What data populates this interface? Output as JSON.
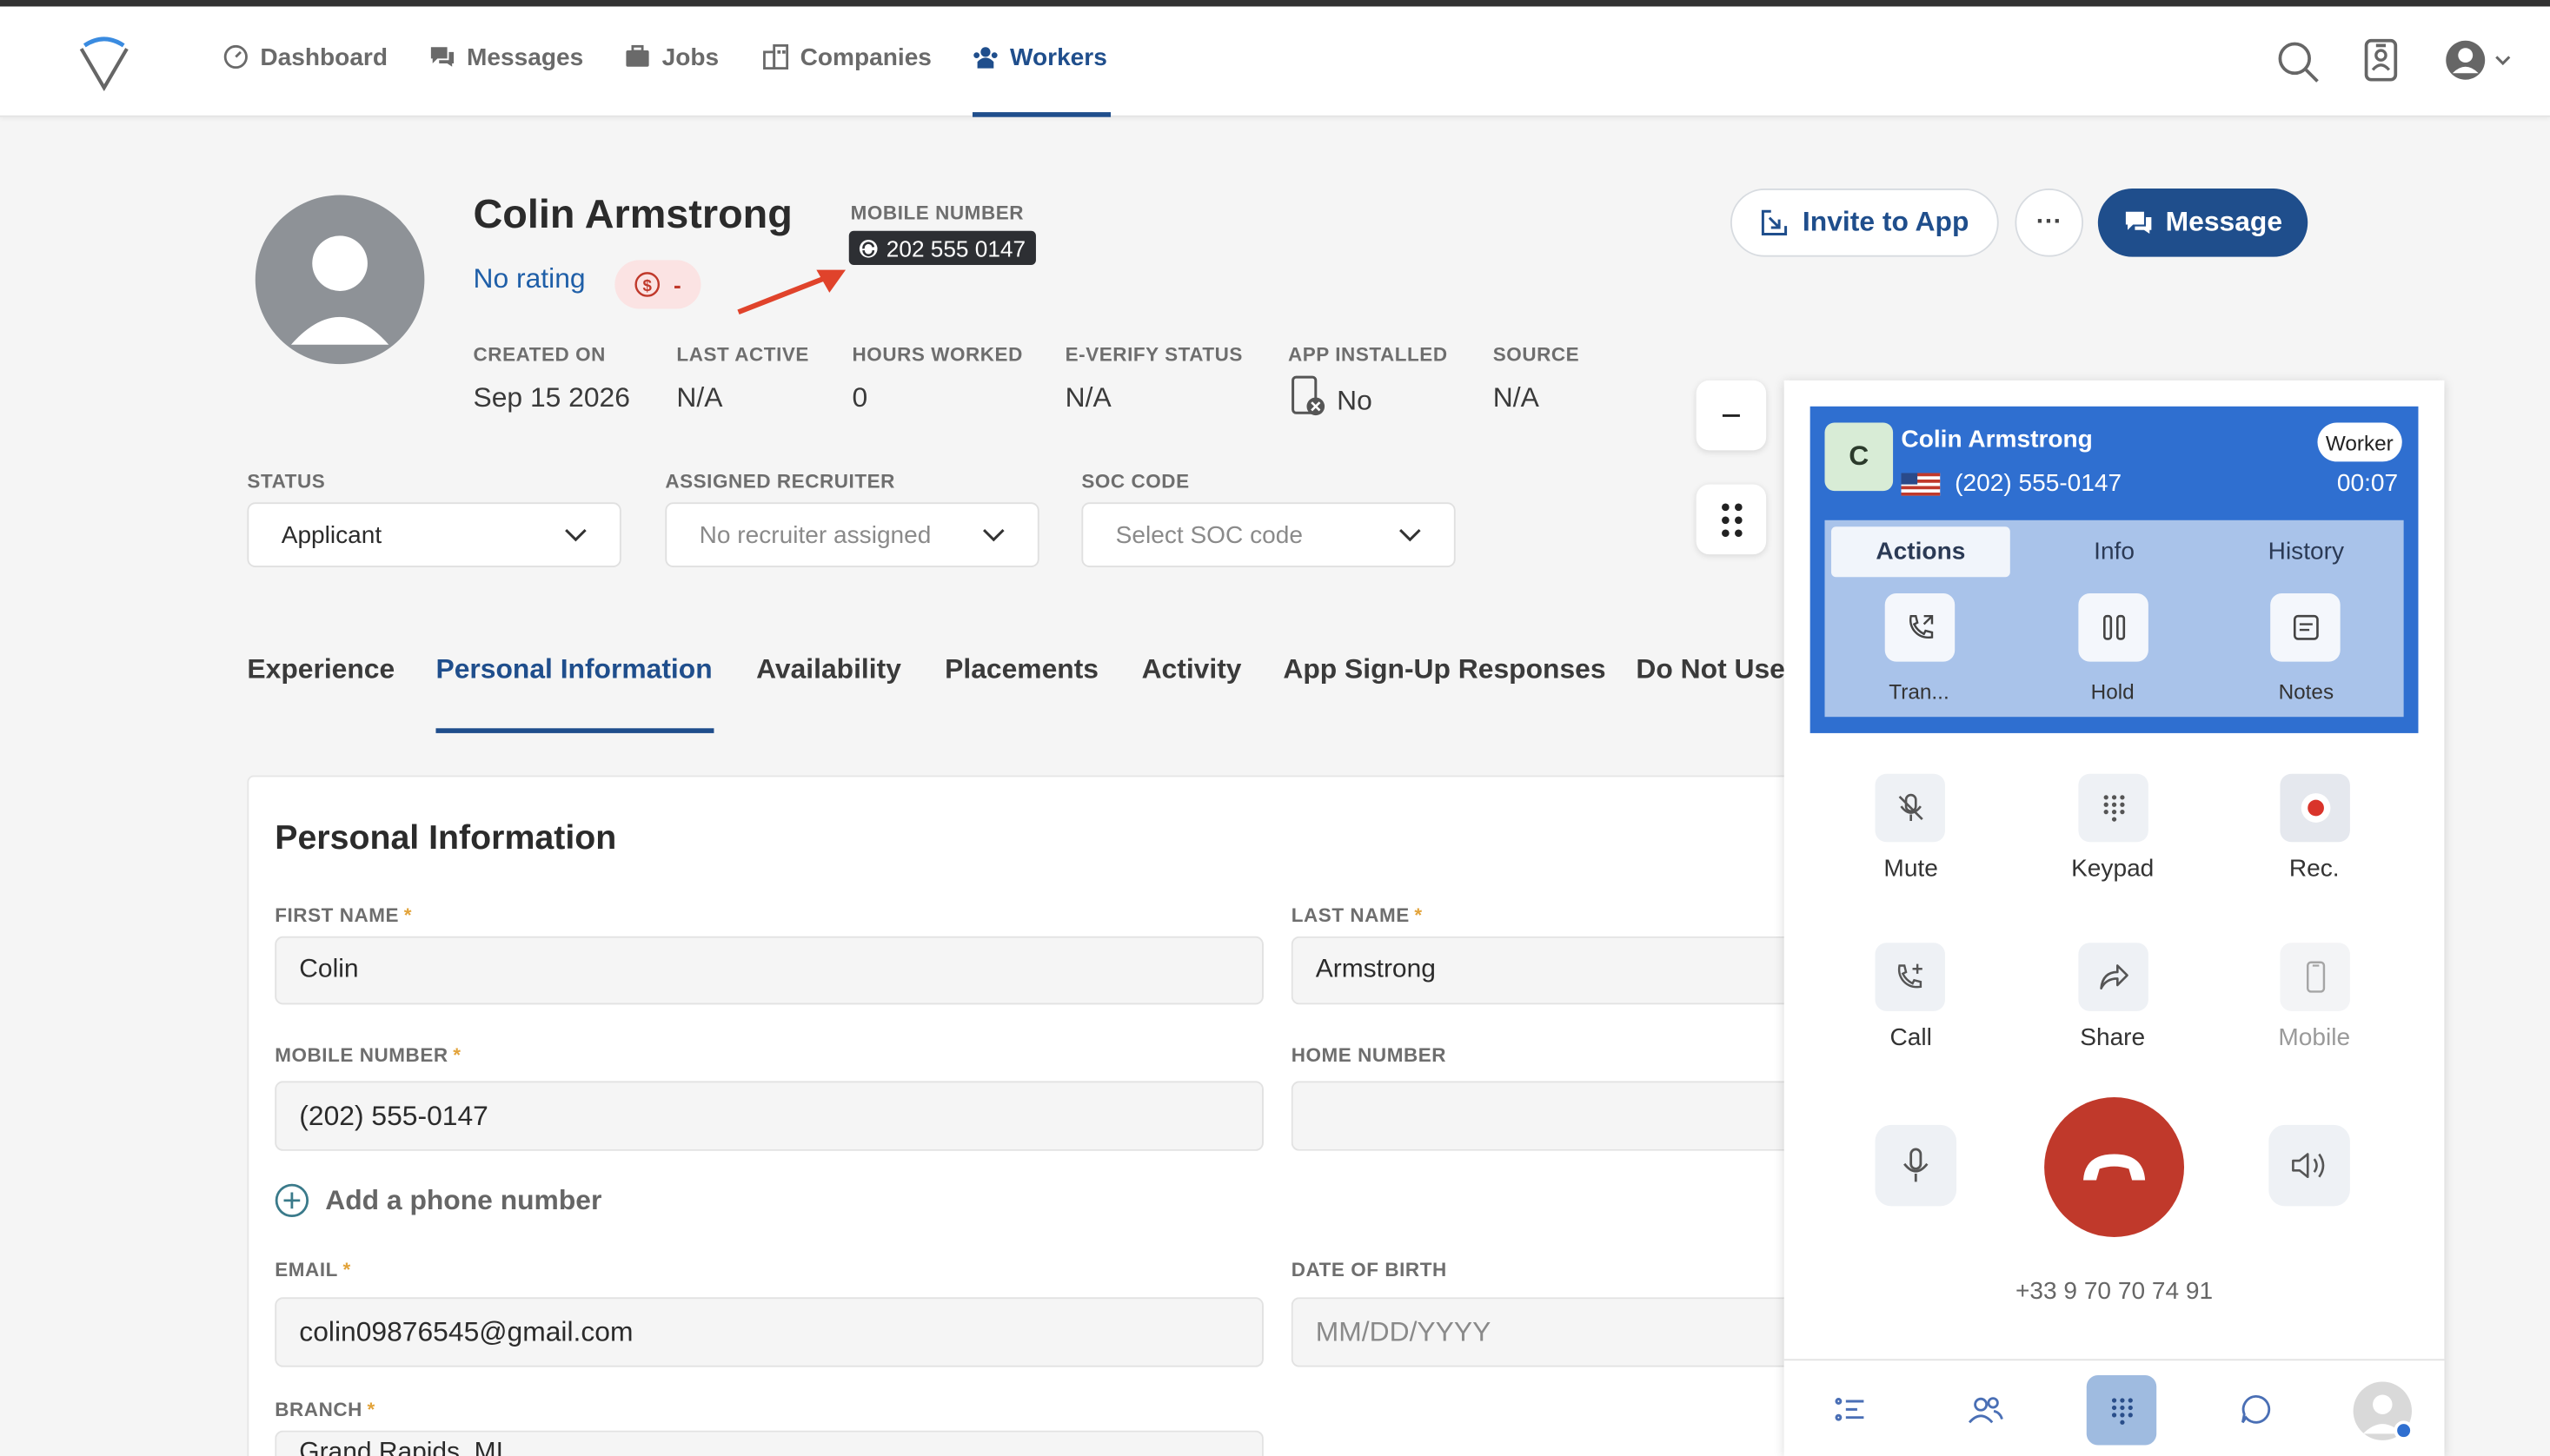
{
  "nav": {
    "items": [
      {
        "label": "Dashboard",
        "icon": "dashboard-icon"
      },
      {
        "label": "Messages",
        "icon": "messages-icon"
      },
      {
        "label": "Jobs",
        "icon": "briefcase-icon"
      },
      {
        "label": "Companies",
        "icon": "building-icon"
      },
      {
        "label": "Workers",
        "icon": "workers-icon",
        "active": true
      }
    ]
  },
  "profile": {
    "name": "Colin Armstrong",
    "rating": "No rating",
    "pay_badge": "-",
    "mobile_label": "MOBILE NUMBER",
    "mobile_value": "202 555 0147",
    "stats": [
      {
        "label": "CREATED ON",
        "value": "Sep 15 2026"
      },
      {
        "label": "LAST ACTIVE",
        "value": "N/A"
      },
      {
        "label": "HOURS WORKED",
        "value": "0"
      },
      {
        "label": "E-VERIFY STATUS",
        "value": "N/A"
      },
      {
        "label": "APP INSTALLED",
        "value": "No"
      },
      {
        "label": "SOURCE",
        "value": "N/A"
      }
    ]
  },
  "actions": {
    "invite": "Invite to App",
    "more": "···",
    "message": "Message"
  },
  "selects": {
    "status_label": "STATUS",
    "status_value": "Applicant",
    "recruiter_label": "ASSIGNED RECRUITER",
    "recruiter_value": "No recruiter assigned",
    "soc_label": "SOC CODE",
    "soc_value": "Select SOC code"
  },
  "tabs": [
    "Experience",
    "Personal Information",
    "Availability",
    "Placements",
    "Activity",
    "App Sign-Up Responses",
    "Do Not Use"
  ],
  "form": {
    "title": "Personal Information",
    "first_name_label": "FIRST NAME",
    "first_name": "Colin",
    "last_name_label": "LAST NAME",
    "last_name": "Armstrong",
    "mobile_label": "MOBILE NUMBER",
    "mobile": "(202) 555-0147",
    "home_label": "HOME NUMBER",
    "home": "",
    "add_phone": "Add a phone number",
    "email_label": "EMAIL",
    "email": "colin09876545@gmail.com",
    "dob_label": "DATE OF BIRTH",
    "dob_placeholder": "MM/DD/YYYY",
    "branch_label": "BRANCH",
    "branch": "Grand Rapids, MI",
    "required_mark": "*"
  },
  "side": {
    "minimize": "−"
  },
  "call": {
    "initial": "C",
    "name": "Colin Armstrong",
    "role": "Worker",
    "number": "(202) 555-0147",
    "timer": "00:07",
    "tabs": [
      "Actions",
      "Info",
      "History"
    ],
    "actions": [
      "Tran...",
      "Hold",
      "Notes"
    ],
    "controls": [
      {
        "label": "Mute",
        "icon": "mute-icon"
      },
      {
        "label": "Keypad",
        "icon": "keypad-icon"
      },
      {
        "label": "Rec.",
        "icon": "record-icon"
      },
      {
        "label": "Call",
        "icon": "call-add-icon"
      },
      {
        "label": "Share",
        "icon": "share-icon"
      },
      {
        "label": "Mobile",
        "icon": "mobile-icon"
      }
    ],
    "caller_id": "+33 9 70 70 74 91"
  },
  "colors": {
    "brand": "#1f4e8c",
    "call_header": "#2f6fd0",
    "hangup": "#c0392b",
    "arrow": "#e0432b"
  }
}
